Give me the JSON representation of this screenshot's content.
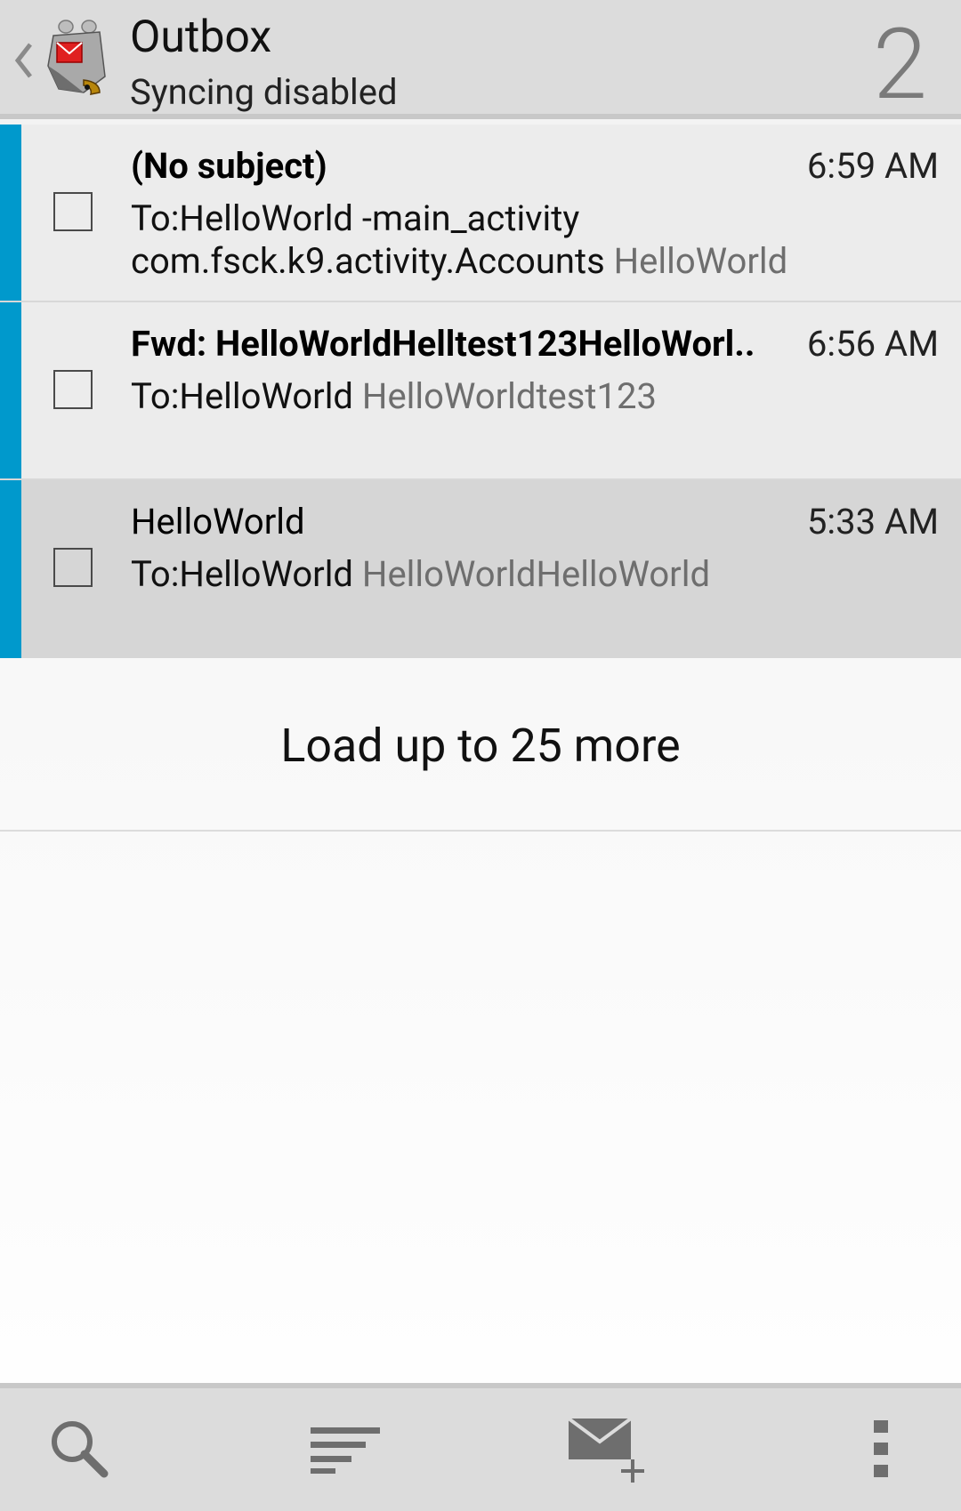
{
  "header": {
    "title": "Outbox",
    "subtitle": "Syncing disabled",
    "count": "2",
    "back_icon": "chevron-left-icon",
    "app_icon": "k9-mail-icon"
  },
  "messages": [
    {
      "subject": "(No subject)",
      "time": "6:59 AM",
      "recipient": "To:HelloWorld -main_activity com.fsck.k9.activity.Accounts",
      "snippet": "HelloWorld",
      "unread": true,
      "selected": false
    },
    {
      "subject": "Fwd: HelloWorldHelltest123HelloWorl..",
      "time": "6:56 AM",
      "recipient": "To:HelloWorld",
      "snippet": "HelloWorldtest123",
      "unread": true,
      "selected": false
    },
    {
      "subject": "HelloWorld",
      "time": "5:33 AM",
      "recipient": "To:HelloWorld",
      "snippet": "HelloWorldHelloWorld",
      "unread": false,
      "selected": true
    }
  ],
  "load_more": "Load up to 25 more",
  "bottom_bar": {
    "icons": [
      "search-icon",
      "sort-icon",
      "compose-icon",
      "overflow-menu-icon"
    ]
  },
  "colors": {
    "accent_stripe": "#0099cc",
    "header_bg": "#dcdcdc"
  }
}
